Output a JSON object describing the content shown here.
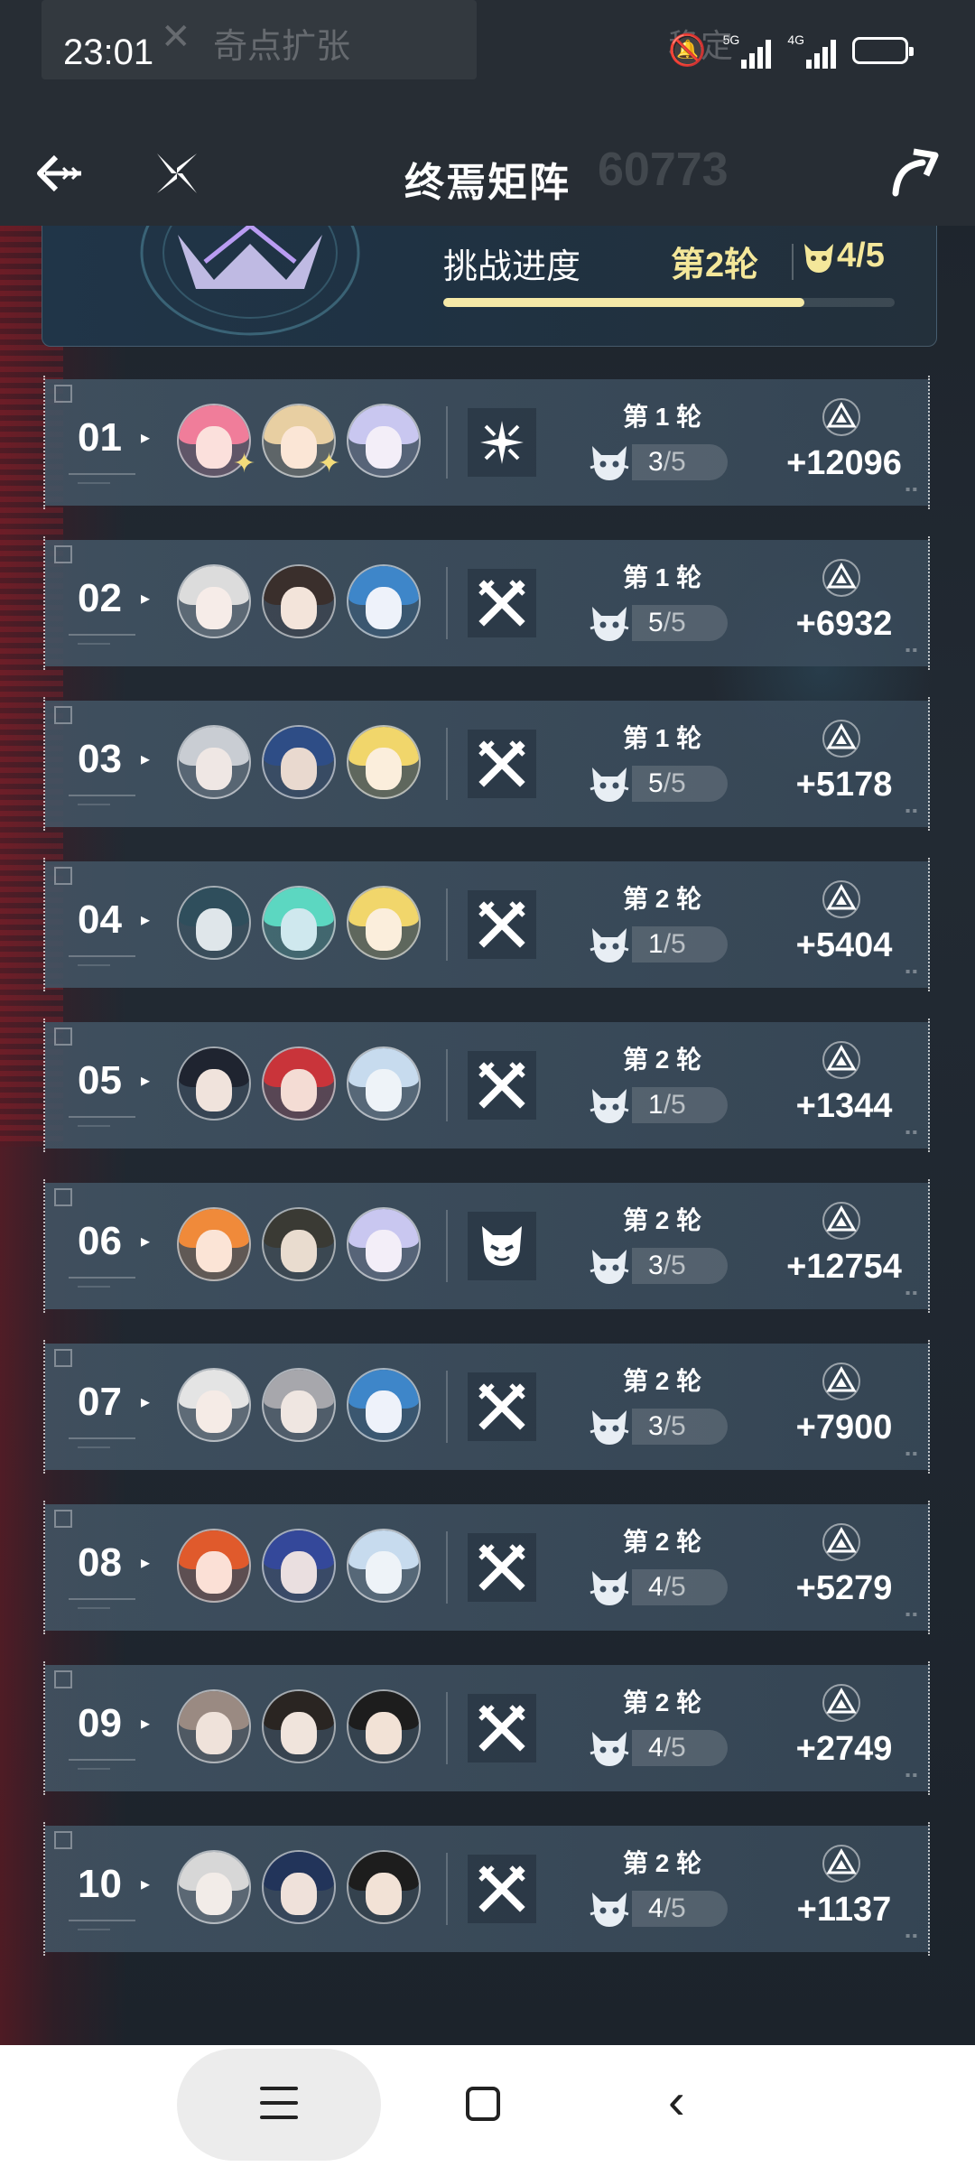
{
  "status_bar": {
    "time": "23:01",
    "notification_ghost": "奇点扩张",
    "carrier_ghost": "稳定",
    "net1": "5G",
    "net2": "4G"
  },
  "header": {
    "title": "终焉矩阵",
    "title_ghost": "60773"
  },
  "progress": {
    "label": "挑战进度",
    "round": "第2轮",
    "enemy_score": "4/5",
    "fill_fraction": 0.8
  },
  "rows": [
    {
      "rank": "01",
      "round": "第 1 轮",
      "score_num": "3",
      "score_den": "/5",
      "points": "+12096",
      "element": "sparkle-cross"
    },
    {
      "rank": "02",
      "round": "第 1 轮",
      "score_num": "5",
      "score_den": "/5",
      "points": "+6932",
      "element": "crossed-swords"
    },
    {
      "rank": "03",
      "round": "第 1 轮",
      "score_num": "5",
      "score_den": "/5",
      "points": "+5178",
      "element": "crossed-swords"
    },
    {
      "rank": "04",
      "round": "第 2 轮",
      "score_num": "1",
      "score_den": "/5",
      "points": "+5404",
      "element": "crossed-swords"
    },
    {
      "rank": "05",
      "round": "第 2 轮",
      "score_num": "1",
      "score_den": "/5",
      "points": "+1344",
      "element": "crossed-swords"
    },
    {
      "rank": "06",
      "round": "第 2 轮",
      "score_num": "3",
      "score_den": "/5",
      "points": "+12754",
      "element": "horned-mask"
    },
    {
      "rank": "07",
      "round": "第 2 轮",
      "score_num": "3",
      "score_den": "/5",
      "points": "+7900",
      "element": "crossed-swords"
    },
    {
      "rank": "08",
      "round": "第 2 轮",
      "score_num": "4",
      "score_den": "/5",
      "points": "+5279",
      "element": "crossed-swords"
    },
    {
      "rank": "09",
      "round": "第 2 轮",
      "score_num": "4",
      "score_den": "/5",
      "points": "+2749",
      "element": "crossed-swords"
    },
    {
      "rank": "10",
      "round": "第 2 轮",
      "score_num": "4",
      "score_den": "/5",
      "points": "+1137",
      "element": "crossed-swords"
    }
  ],
  "avatars": [
    [
      {
        "hair": "#f07d9a",
        "face": "#fbe0dc",
        "star": true
      },
      {
        "hair": "#e8cfa2",
        "face": "#fbe6d6",
        "star": true
      },
      {
        "hair": "#c9c7f0",
        "face": "#f3eef8",
        "star": false
      }
    ],
    [
      {
        "hair": "#dcdcdc",
        "face": "#f6ece8",
        "star": false
      },
      {
        "hair": "#3a2f2c",
        "face": "#f3e4da",
        "star": false
      },
      {
        "hair": "#3e86c9",
        "face": "#eef2fa",
        "star": false
      }
    ],
    [
      {
        "hair": "#c9cdd3",
        "face": "#efe7e4",
        "star": false
      },
      {
        "hair": "#2e4d86",
        "face": "#e9d9cf",
        "star": false
      },
      {
        "hair": "#f1d66b",
        "face": "#fbeedc",
        "star": false
      }
    ],
    [
      {
        "hair": "#2f4e5c",
        "face": "#dfe6ea",
        "star": false
      },
      {
        "hair": "#5cd7c1",
        "face": "#cfe8ee",
        "star": false
      },
      {
        "hair": "#f1d66b",
        "face": "#fbeedc",
        "star": false
      }
    ],
    [
      {
        "hair": "#1f2430",
        "face": "#f0e3dc",
        "star": false
      },
      {
        "hair": "#c9343a",
        "face": "#f4dcd4",
        "star": false
      },
      {
        "hair": "#c7dbee",
        "face": "#eef3f8",
        "star": false
      }
    ],
    [
      {
        "hair": "#f08a3a",
        "face": "#fbe4d6",
        "star": false
      },
      {
        "hair": "#3a3a34",
        "face": "#e9dccf",
        "star": false
      },
      {
        "hair": "#c9c7f0",
        "face": "#f3eef8",
        "star": false
      }
    ],
    [
      {
        "hair": "#e4e4e4",
        "face": "#f5ebe6",
        "star": false
      },
      {
        "hair": "#a7a7ac",
        "face": "#efe6e1",
        "star": false
      },
      {
        "hair": "#3e86c9",
        "face": "#eef2fa",
        "star": false
      }
    ],
    [
      {
        "hair": "#e05a2c",
        "face": "#fbe0d6",
        "star": false
      },
      {
        "hair": "#34489a",
        "face": "#eadfe0",
        "star": false
      },
      {
        "hair": "#c7dbee",
        "face": "#eef3f8",
        "star": false
      }
    ],
    [
      {
        "hair": "#9a8a82",
        "face": "#efe2da",
        "star": false
      },
      {
        "hair": "#2a2522",
        "face": "#f0e4dc",
        "star": false
      },
      {
        "hair": "#1d1d1d",
        "face": "#f2e2d6",
        "star": false
      }
    ],
    [
      {
        "hair": "#d7d7d7",
        "face": "#f2ece8",
        "star": false
      },
      {
        "hair": "#22345a",
        "face": "#efe1da",
        "star": false
      },
      {
        "hair": "#1d1d1d",
        "face": "#f2e2d6",
        "star": false
      }
    ]
  ],
  "colors": {
    "accent_yellow": "#f4e79a",
    "row_bg": "#42546a"
  },
  "icons": {
    "back": "back-arrow-icon",
    "logo": "pinwheel-logo-icon",
    "share": "share-arrow-icon",
    "enemy": "demon-face-icon",
    "points": "triangle-emblem-icon"
  }
}
